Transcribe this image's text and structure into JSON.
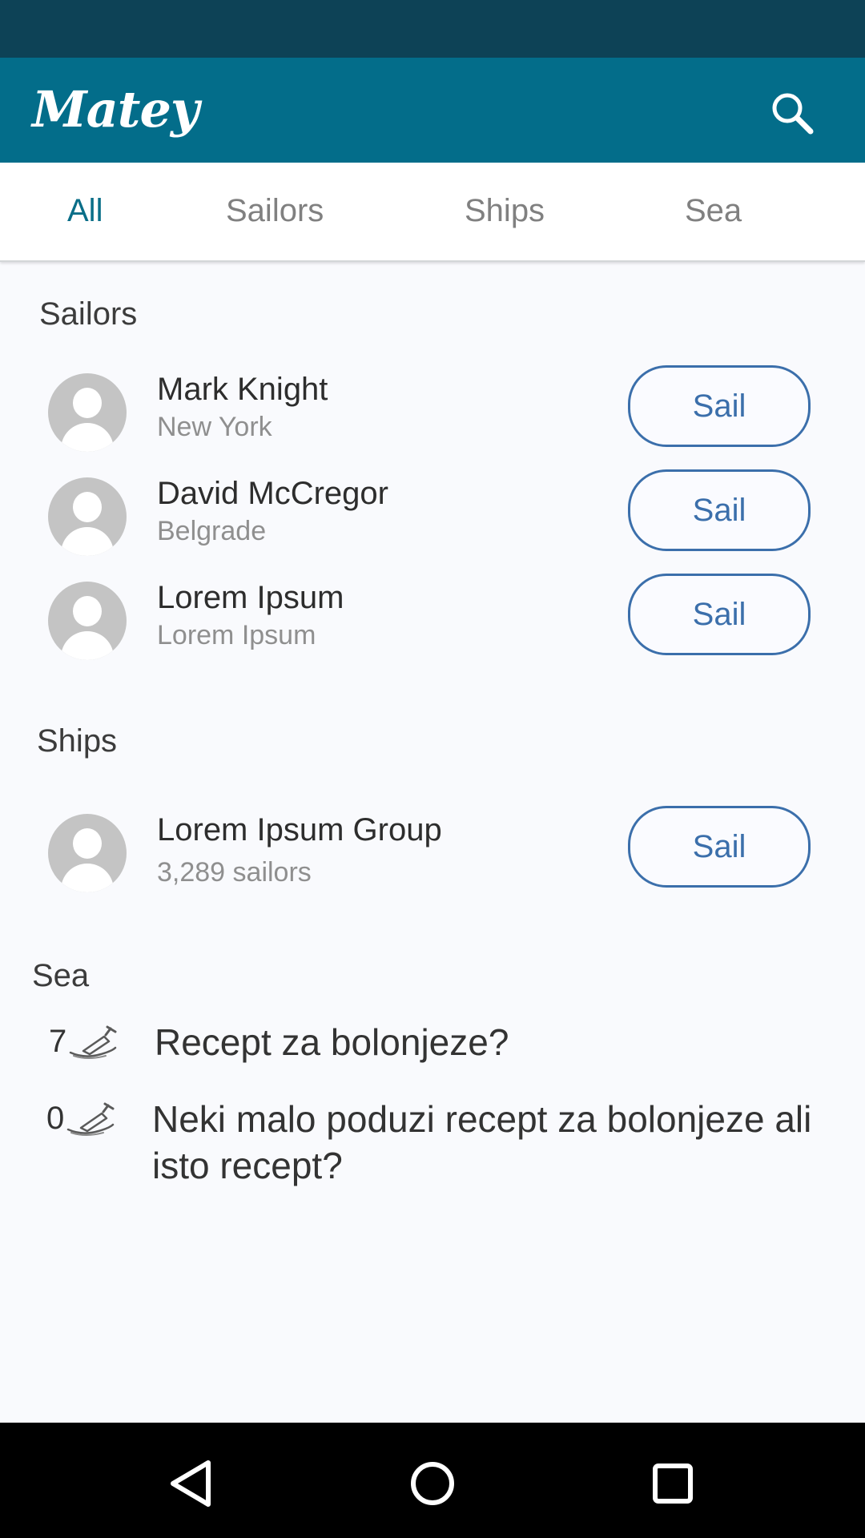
{
  "app": {
    "title": "Matey",
    "theme_color": "#036d8a",
    "status_color": "#0d4256"
  },
  "header": {
    "search_icon": "search-icon"
  },
  "tabs": [
    {
      "label": "All",
      "active": true
    },
    {
      "label": "Sailors",
      "active": false
    },
    {
      "label": "Ships",
      "active": false
    },
    {
      "label": "Sea",
      "active": false
    }
  ],
  "sailors": {
    "title": "Sailors",
    "items": [
      {
        "name": "Mark Knight",
        "sub": "New York",
        "button": "Sail"
      },
      {
        "name": "David McCregor",
        "sub": "Belgrade",
        "button": "Sail"
      },
      {
        "name": "Lorem Ipsum",
        "sub": "Lorem Ipsum",
        "button": "Sail"
      }
    ]
  },
  "ships": {
    "title": "Ships",
    "items": [
      {
        "name": "Lorem Ipsum Group",
        "sub": "3,289 sailors",
        "button": "Sail"
      }
    ]
  },
  "sea": {
    "title": "Sea",
    "items": [
      {
        "count": "7",
        "text": "Recept za bolonjeze?",
        "icon": "bottle-icon"
      },
      {
        "count": "0",
        "text": "Neki malo poduzi recept za bolonjeze ali isto recept?",
        "icon": "bottle-icon"
      }
    ]
  },
  "nav": {
    "back_icon": "back-icon",
    "home_icon": "home-icon",
    "recents_icon": "recents-icon"
  }
}
